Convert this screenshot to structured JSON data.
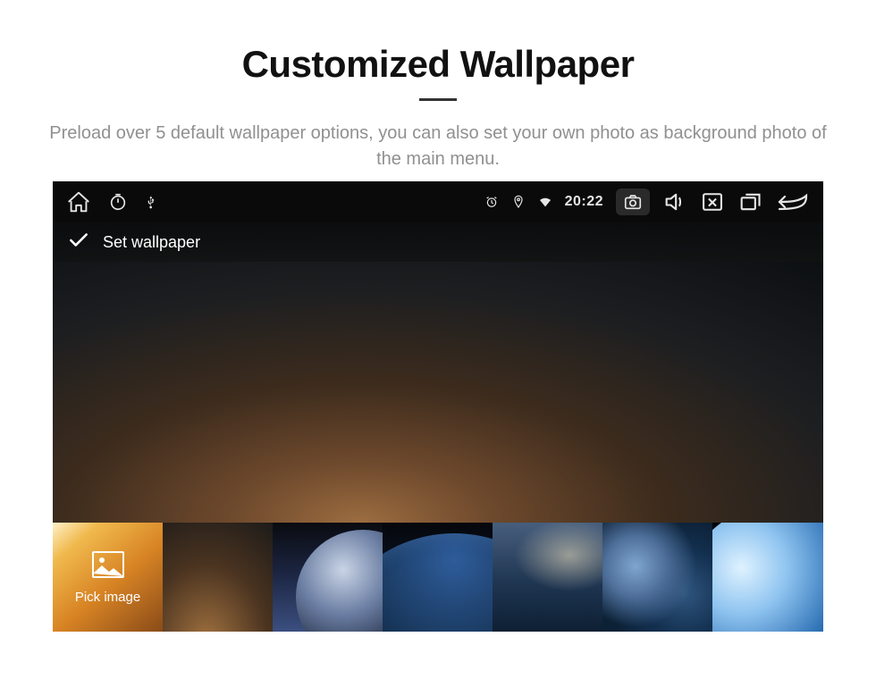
{
  "page": {
    "title": "Customized Wallpaper",
    "subtitle": "Preload over 5 default wallpaper options, you can also set your own photo as background photo of the main menu."
  },
  "statusbar": {
    "time": "20:22"
  },
  "screen": {
    "title": "Set wallpaper"
  },
  "strip": {
    "pick_label": "Pick image"
  }
}
